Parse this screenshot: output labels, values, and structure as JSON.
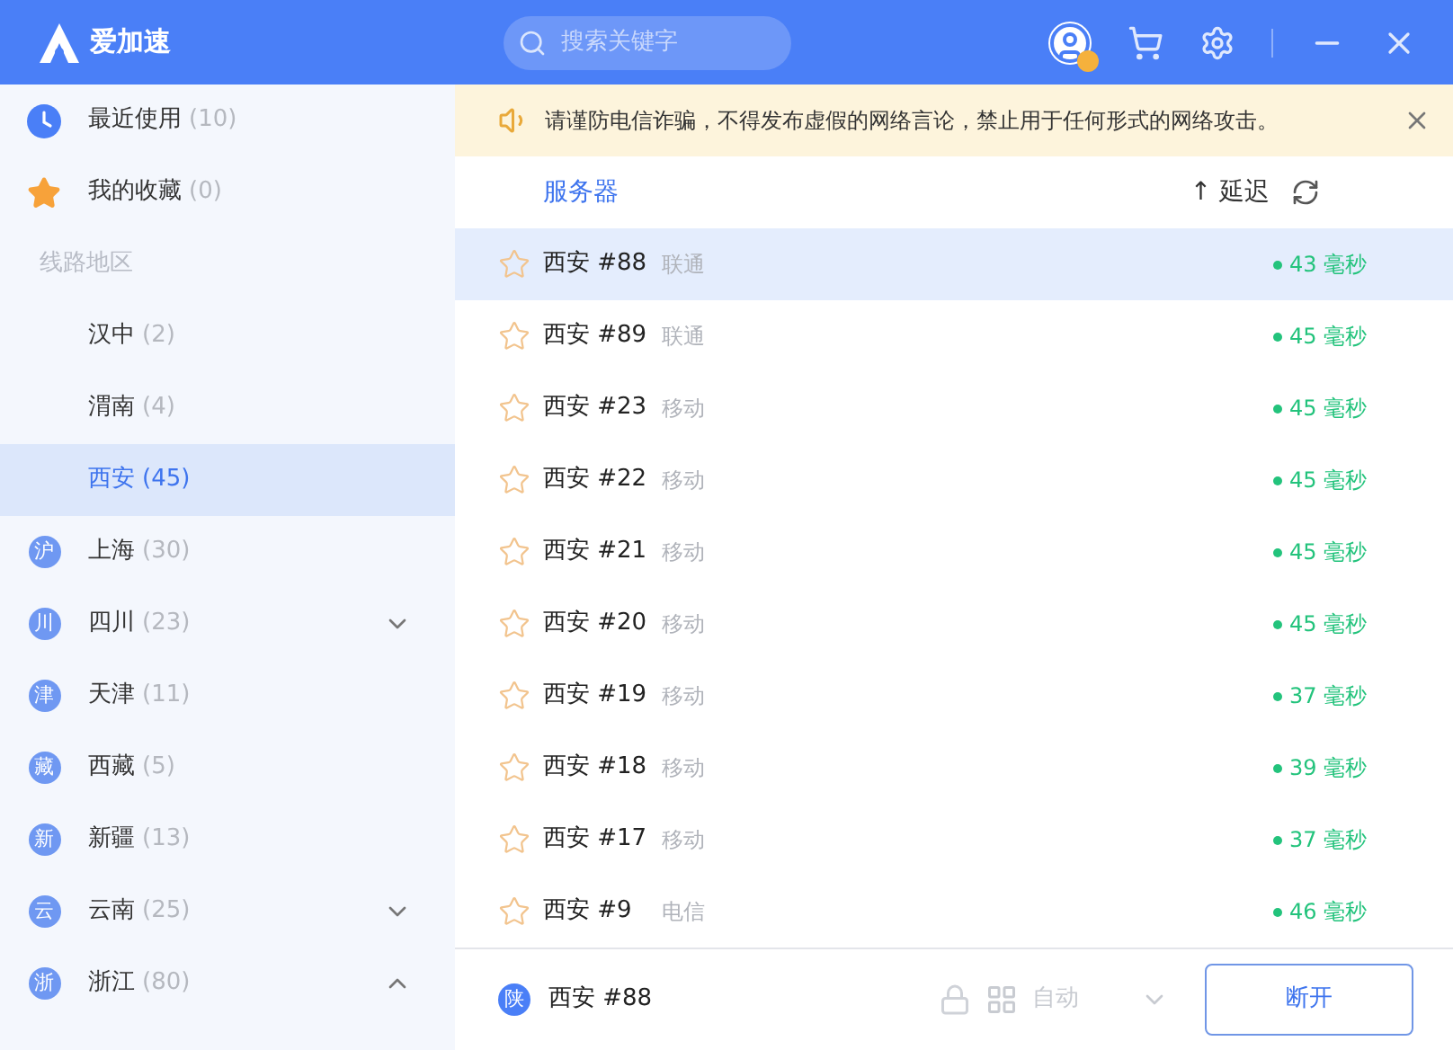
{
  "header": {
    "logo_text": "爱加速",
    "search": {
      "placeholder": "搜索关键字"
    }
  },
  "sidebar": {
    "items": [
      {
        "kind": "recent",
        "label": "最近使用",
        "count": "(10)",
        "selected": false
      },
      {
        "kind": "favorites",
        "label": "我的收藏",
        "count": "(0)",
        "selected": false
      },
      {
        "kind": "heading",
        "label": "线路地区"
      },
      {
        "kind": "city",
        "label": "汉中",
        "count": "(2)",
        "selected": false
      },
      {
        "kind": "city",
        "label": "渭南",
        "count": "(4)",
        "selected": false
      },
      {
        "kind": "city",
        "label": "西安",
        "count": "(45)",
        "selected": true
      },
      {
        "kind": "province",
        "badge": "沪",
        "label": "上海",
        "count": "(30)",
        "selected": false
      },
      {
        "kind": "province",
        "badge": "川",
        "label": "四川",
        "count": "(23)",
        "selected": false,
        "expanded": false
      },
      {
        "kind": "province",
        "badge": "津",
        "label": "天津",
        "count": "(11)",
        "selected": false
      },
      {
        "kind": "province",
        "badge": "藏",
        "label": "西藏",
        "count": "(5)",
        "selected": false
      },
      {
        "kind": "province",
        "badge": "新",
        "label": "新疆",
        "count": "(13)",
        "selected": false
      },
      {
        "kind": "province",
        "badge": "云",
        "label": "云南",
        "count": "(25)",
        "selected": false,
        "expanded": false
      },
      {
        "kind": "province",
        "badge": "浙",
        "label": "浙江",
        "count": "(80)",
        "selected": false,
        "expanded": true
      }
    ]
  },
  "notice": {
    "text": "请谨防电信诈骗，不得发布虚假的网络言论，禁止用于任何形式的网络攻击。"
  },
  "table": {
    "columns": [
      {
        "label": "服务器"
      },
      {
        "label": "延迟",
        "sort": "↑"
      }
    ],
    "rows": [
      {
        "name": "西安 #88",
        "carrier": "联通",
        "latency": "43 毫秒",
        "selected": true
      },
      {
        "name": "西安 #89",
        "carrier": "联通",
        "latency": "45 毫秒",
        "selected": false
      },
      {
        "name": "西安 #23",
        "carrier": "移动",
        "latency": "45 毫秒",
        "selected": false
      },
      {
        "name": "西安 #22",
        "carrier": "移动",
        "latency": "45 毫秒",
        "selected": false
      },
      {
        "name": "西安 #21",
        "carrier": "移动",
        "latency": "45 毫秒",
        "selected": false
      },
      {
        "name": "西安 #20",
        "carrier": "移动",
        "latency": "45 毫秒",
        "selected": false
      },
      {
        "name": "西安 #19",
        "carrier": "移动",
        "latency": "37 毫秒",
        "selected": false
      },
      {
        "name": "西安 #18",
        "carrier": "移动",
        "latency": "39 毫秒",
        "selected": false
      },
      {
        "name": "西安 #17",
        "carrier": "移动",
        "latency": "37 毫秒",
        "selected": false
      },
      {
        "name": "西安 #9",
        "carrier": "电信",
        "latency": "46 毫秒",
        "selected": false
      }
    ]
  },
  "footer": {
    "badge": "陕",
    "server": "西安 #88",
    "mode": "自动",
    "button": "断开"
  }
}
